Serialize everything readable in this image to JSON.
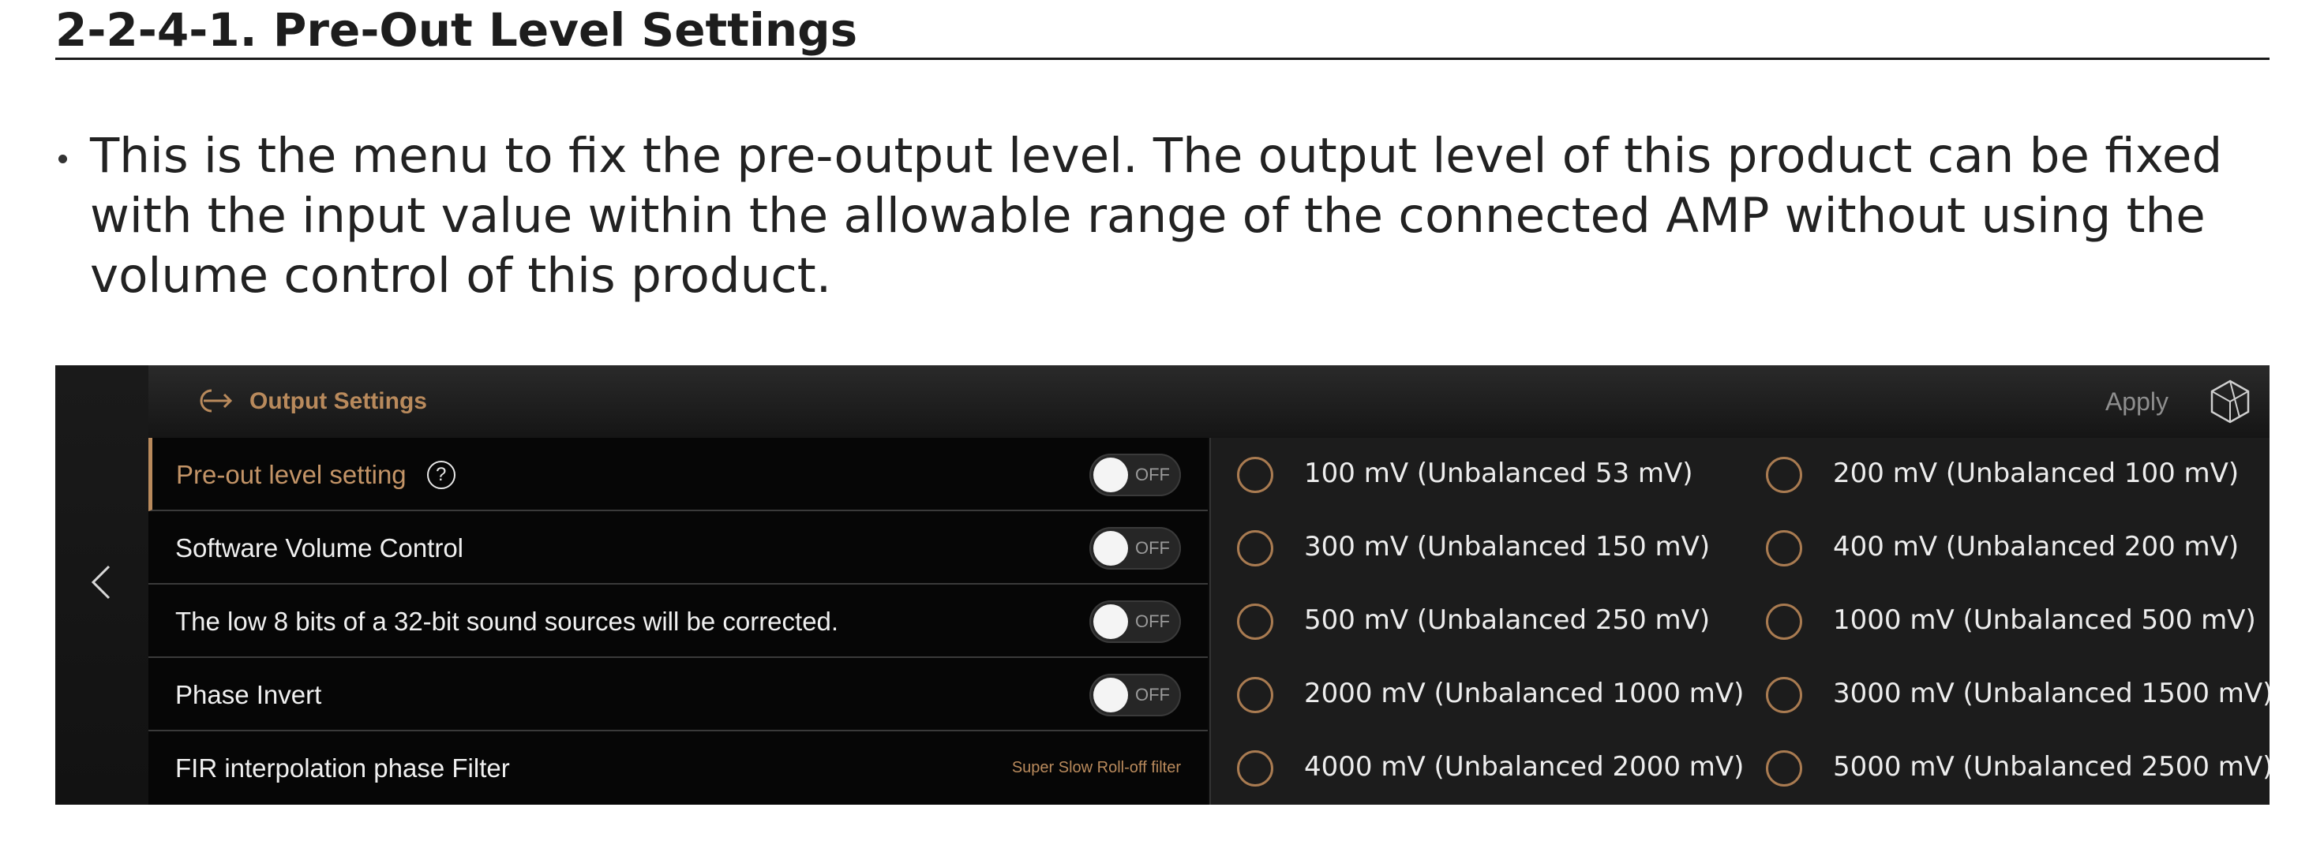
{
  "doc": {
    "heading": "2-2-4-1. Pre-Out Level Settings",
    "bullet": "This is the menu to fix the pre-output level. The output level of this product can be fixed with the input value within the allowable range of the connected AMP without using the volume control of this product."
  },
  "screen": {
    "header": {
      "icon": "output-arrow-icon",
      "title": "Output Settings",
      "apply_label": "Apply",
      "logo": "brand-logo-icon"
    },
    "accent_color": "#b98a5c",
    "settings": [
      {
        "label": "Pre-out level setting",
        "help": "?",
        "toggle": "OFF",
        "active": true
      },
      {
        "label": "Software Volume Control",
        "toggle": "OFF"
      },
      {
        "label": "The low 8 bits of a 32-bit sound sources will be corrected.",
        "toggle": "OFF"
      },
      {
        "label": "Phase Invert",
        "toggle": "OFF"
      },
      {
        "label": "FIR interpolation phase Filter",
        "value": "Super Slow Roll-off filter"
      }
    ],
    "pre_out_options": [
      "100 mV (Unbalanced 53 mV)",
      "200 mV (Unbalanced 100 mV)",
      "300 mV (Unbalanced 150 mV)",
      "400 mV (Unbalanced 200 mV)",
      "500 mV (Unbalanced 250 mV)",
      "1000 mV (Unbalanced 500 mV)",
      "2000 mV (Unbalanced 1000 mV)",
      "3000 mV (Unbalanced 1500 mV)",
      "4000 mV (Unbalanced 2000 mV)",
      "5000 mV (Unbalanced 2500 mV)"
    ]
  }
}
